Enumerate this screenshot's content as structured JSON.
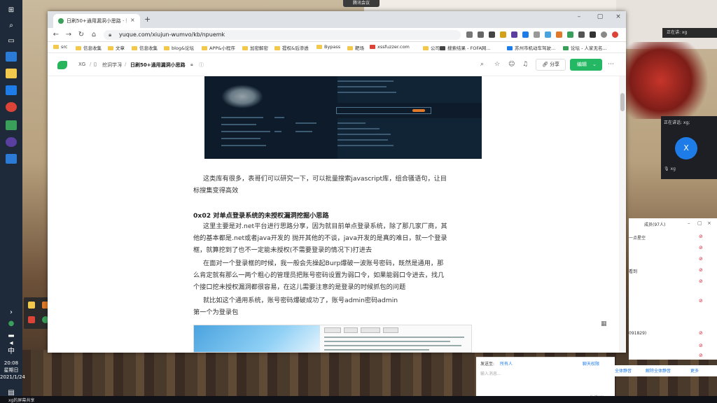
{
  "desktop": {
    "meeting_bar_label": "腾讯会议",
    "side_badge": "正在讲: xg",
    "taskbar_time": "20:08",
    "taskbar_day": "星期日",
    "taskbar_date": "2021/1/24",
    "taskbar_ime": "中",
    "bottom_label": "xg的屏幕共享"
  },
  "browser": {
    "tab_title": "日刷50+通用漏洞小思路 · 语雀",
    "url": "yuque.com/xiujun-wumvo/kb/npuemk",
    "bookmarks": [
      "src",
      "信息收集",
      "文章",
      "信息收集",
      "blog&论坛",
      "APP&小程序",
      "加密解密",
      "提权&后渗透",
      "Bypass",
      "靶场",
      "xssfuzzer.com",
      "公司",
      "搜索结果 - FOFA网...",
      "苏州市机动车驾驶...",
      "论坛 - 人家无名..."
    ]
  },
  "yuque": {
    "breadcrumb": [
      "XG",
      "挖洞学习",
      "日刷50+通用漏洞小思路"
    ],
    "share_label": "分享",
    "edit_label": "编辑"
  },
  "article": {
    "para1_line1": "这类库有很多，表哥们可以研究一下，可以批量搜索javascript库，组合骚语句，让目",
    "para1_line2": "标搜集变得高效",
    "heading": "0x02 对单点登录系统的未授权漏洞挖掘小思路",
    "para2_line1": "这里主要是对.net平台进行思路分享，因为就目前单点登录系统，除了那几家厂商，其",
    "para2_line2": "他的基本都是.net或者java开发的 抛开其他的不谈，java开发的是真的难日，就一个登录",
    "para2_line3": "框，就算挖到了也不一定能未授权(不需要登录的情况下)打进去",
    "para3_line1": "在面对一个登录框的时候，我一般会先操起Burp爆破一波账号密码，既然是通用，那",
    "para3_line2": "么肯定就有那么一两个粗心的管理员把账号密码设置为弱口令，如果能弱口令进去，找几",
    "para3_line3": "个接口挖未授权漏洞都很容易，在这儿需要注意的是登录的时候抓包的问题",
    "para4": "就比如这个通用系统，账号密码爆破成功了，账号admin密码admin",
    "para5": "第一个为登录包"
  },
  "meeting": {
    "video_title": "正在讲话: xg;",
    "video_avatar": "X",
    "video_name": "xg",
    "members_title": "成员(97人)",
    "members": [
      {
        "name": "一点星空"
      },
      {
        "name": ""
      },
      {
        "name": ""
      },
      {
        "name": "看到"
      },
      {
        "name": ""
      },
      {
        "name": ""
      },
      {
        "name": "091829)"
      },
      {
        "name": ""
      },
      {
        "name": ""
      }
    ],
    "chat_to_label": "发送至:",
    "chat_to_value": "所有人",
    "chat_permission": "聊天权限",
    "chat_placeholder": "输入消息...",
    "chat_send": "发送(S)",
    "mute_all": "全体静音",
    "unmute_all": "解除全体静音",
    "more": "更多"
  },
  "colors": {
    "yuque_green": "#25b864",
    "link_blue": "#1e7ce8"
  }
}
